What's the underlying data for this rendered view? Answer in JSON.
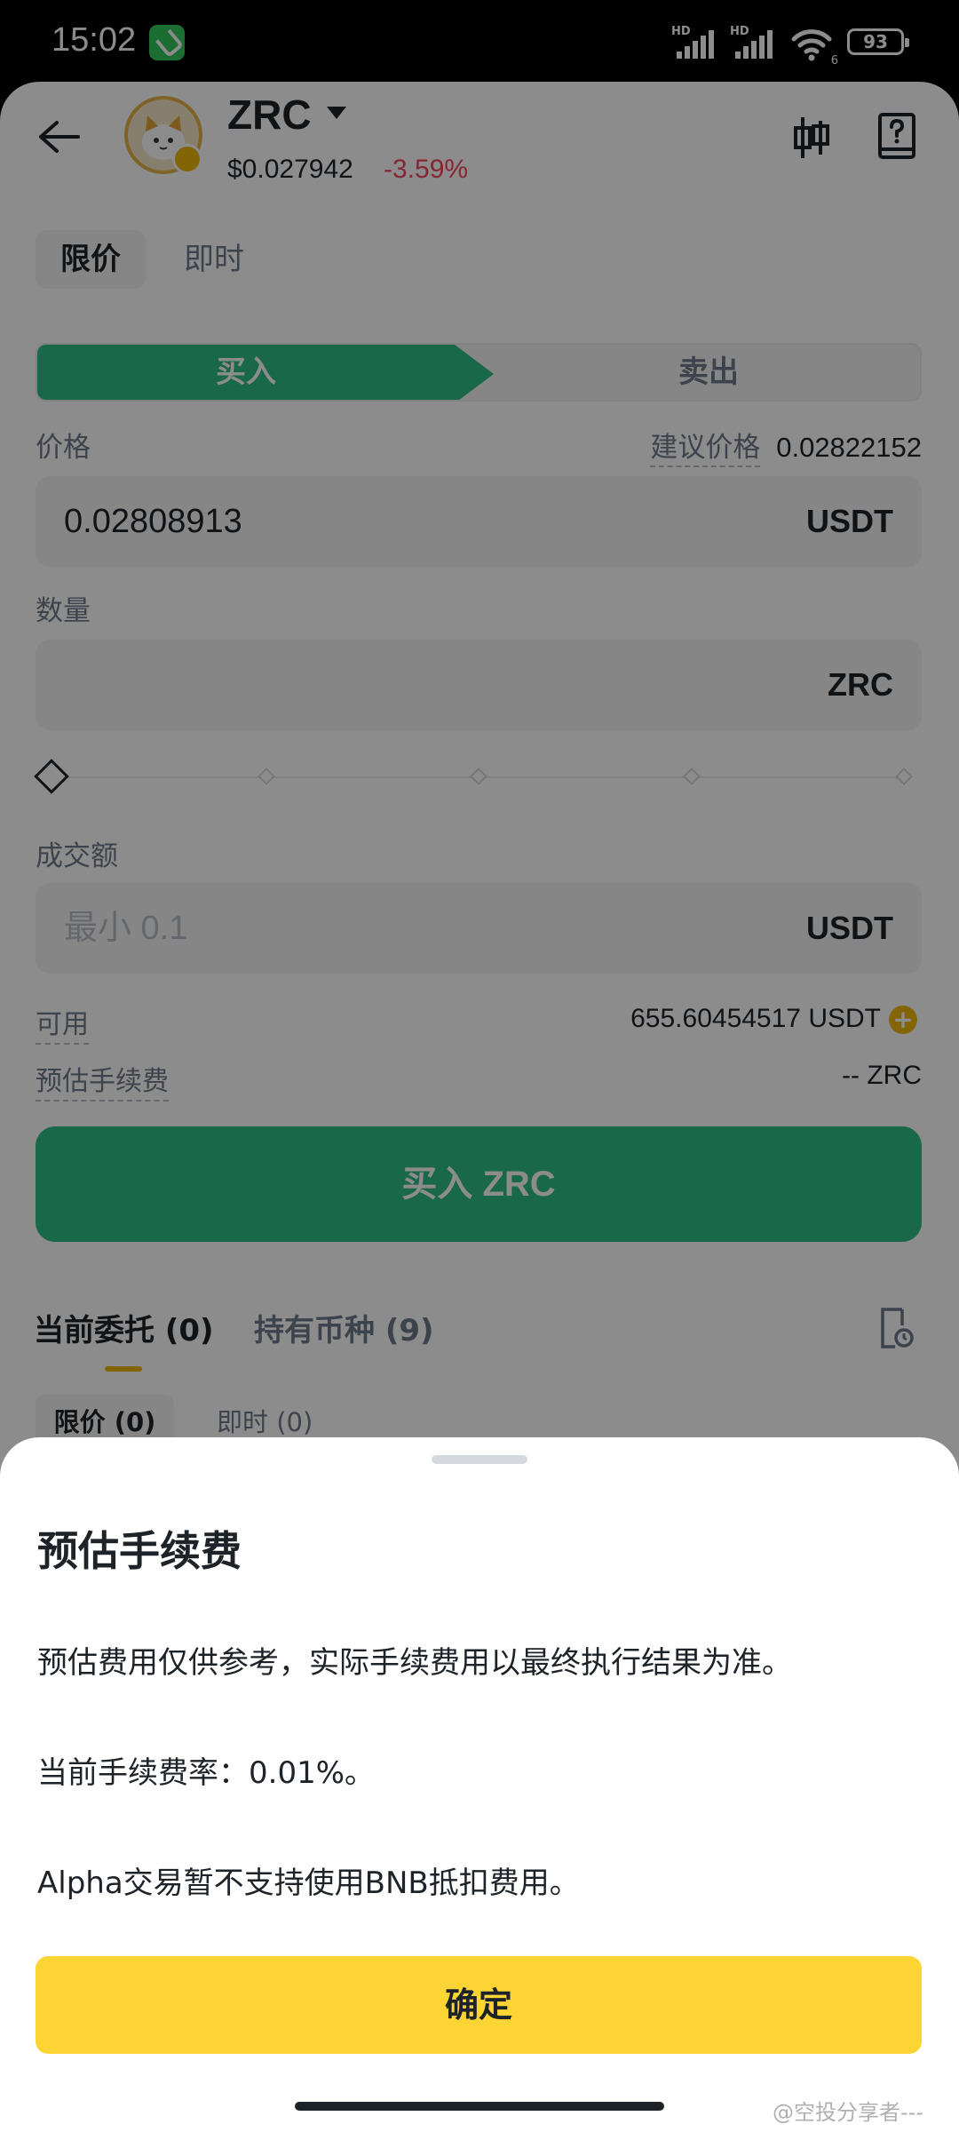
{
  "status_bar": {
    "time": "15:02",
    "signal1_label": "HD",
    "signal2_label": "HD",
    "wifi_label": "6",
    "battery": "93"
  },
  "header": {
    "coin_name": "ZRC",
    "price": "$0.027942",
    "change": "-3.59%"
  },
  "order_type_tabs": [
    "限价",
    "即时"
  ],
  "side": {
    "buy": "买入",
    "sell": "卖出"
  },
  "price": {
    "label": "价格",
    "suggested_label": "建议价格",
    "suggested_value": "0.02822152",
    "value": "0.02808913",
    "unit": "USDT"
  },
  "quantity": {
    "label": "数量",
    "value": "",
    "unit": "ZRC"
  },
  "total": {
    "label": "成交额",
    "placeholder": "最小 0.1",
    "unit": "USDT"
  },
  "available": {
    "label": "可用",
    "value": "655.60454517 USDT"
  },
  "est_fee": {
    "label": "预估手续费",
    "value": "-- ZRC"
  },
  "buy_button": "买入 ZRC",
  "orders_tabs": {
    "open": "当前委托 (0)",
    "holdings": "持有币种 (9)"
  },
  "orders_subtabs": [
    "限价 (0)",
    "即时 (0)"
  ],
  "sheet": {
    "title": "预估手续费",
    "p1": "预估费用仅供参考，实际手续费用以最终执行结果为准。",
    "p2": "当前手续费率：0.01%。",
    "p3": "Alpha交易暂不支持使用BNB抵扣费用。",
    "confirm": "确定"
  },
  "watermark": "@空投分享者---",
  "colors": {
    "buy_green": "#2ebd85",
    "sell_red": "#f6465d",
    "brand_yellow": "#fcd535"
  }
}
